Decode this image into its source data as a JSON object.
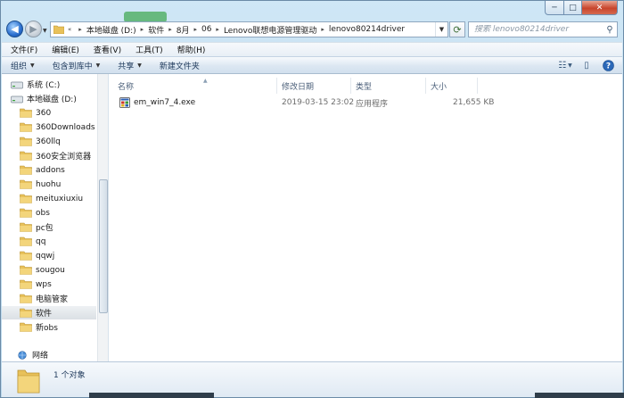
{
  "window": {
    "caption": {
      "minimize": "─",
      "maximize": "□",
      "close": "✕"
    }
  },
  "nav": {
    "back_icon": "back-arrow-icon",
    "forward_icon": "forward-arrow-icon",
    "breadcrumb_overflow": "«",
    "breadcrumbs": [
      "本地磁盘 (D:)",
      "软件",
      "8月",
      "06",
      "Lenovo联想电源管理驱动",
      "lenovo80214driver"
    ],
    "search_placeholder": "搜索 lenovo80214driver"
  },
  "menubar": {
    "items": [
      "文件(F)",
      "编辑(E)",
      "查看(V)",
      "工具(T)",
      "帮助(H)"
    ]
  },
  "commandbar": {
    "organize": "组织",
    "include_in_library": "包含到库中",
    "share": "共享",
    "new_folder": "新建文件夹"
  },
  "tree": {
    "items": [
      {
        "label": "系统 (C:)",
        "kind": "drive"
      },
      {
        "label": "本地磁盘 (D:)",
        "kind": "drive"
      },
      {
        "label": "360",
        "kind": "folder"
      },
      {
        "label": "360Downloads",
        "kind": "folder"
      },
      {
        "label": "360llq",
        "kind": "folder"
      },
      {
        "label": "360安全浏览器",
        "kind": "folder"
      },
      {
        "label": "addons",
        "kind": "folder"
      },
      {
        "label": "huohu",
        "kind": "folder"
      },
      {
        "label": "meituxiuxiu",
        "kind": "folder"
      },
      {
        "label": "obs",
        "kind": "folder"
      },
      {
        "label": "pc包",
        "kind": "folder"
      },
      {
        "label": "qq",
        "kind": "folder"
      },
      {
        "label": "qqwj",
        "kind": "folder"
      },
      {
        "label": "sougou",
        "kind": "folder"
      },
      {
        "label": "wps",
        "kind": "folder"
      },
      {
        "label": "电脑管家",
        "kind": "folder"
      },
      {
        "label": "软件",
        "kind": "folder",
        "selected": true
      },
      {
        "label": "新obs",
        "kind": "folder"
      }
    ],
    "network": "网络"
  },
  "filelist": {
    "columns": {
      "name": "名称",
      "modified": "修改日期",
      "type": "类型",
      "size": "大小"
    },
    "rows": [
      {
        "name": "em_win7_4.exe",
        "modified": "2019-03-15 23:02",
        "type": "应用程序",
        "size": "21,655 KB"
      }
    ]
  },
  "details": {
    "count": "1 个对象"
  },
  "colors": {
    "accent": "#1e395b",
    "folder": "#e8c15a",
    "window_frame": "#c3ddee"
  }
}
